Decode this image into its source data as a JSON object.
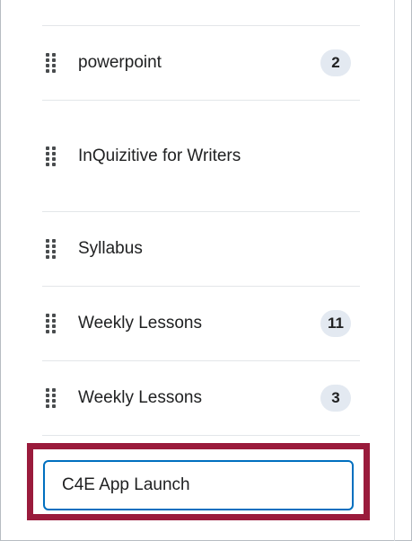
{
  "nav_list": {
    "items": [
      {
        "label": "powerpoint",
        "count": "2"
      },
      {
        "label": "InQuizitive for Writers",
        "count": ""
      },
      {
        "label": "Syllabus",
        "count": ""
      },
      {
        "label": "Weekly Lessons",
        "count": "11"
      },
      {
        "label": "Weekly Lessons",
        "count": "3"
      }
    ]
  },
  "new_item_input": {
    "value": "C4E App Launch"
  },
  "colors": {
    "highlight_border": "#9a1b3c",
    "input_focus_border": "#006fbf",
    "badge_background": "#e3e9f1"
  }
}
